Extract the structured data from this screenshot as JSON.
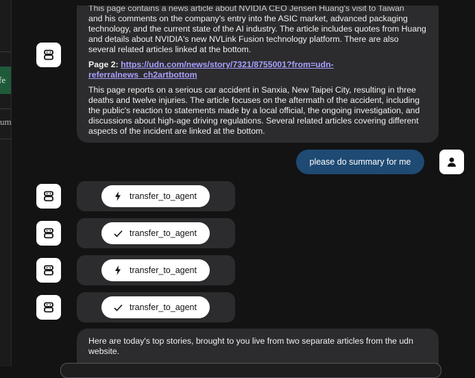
{
  "sidebar_fragments": {
    "item_a": "fe",
    "item_b": "um"
  },
  "messages": {
    "summary_top": {
      "clipped_line": "This page contains a news article about NVIDIA CEO Jensen Huang's visit to Taiwan",
      "para1": "and his comments on the company's entry into the ASIC market, advanced packaging technology, and the current state of the AI industry. The article includes quotes from Huang and details about NVIDIA's new NVLink Fusion technology platform. There are also several related articles linked at the bottom.",
      "page2_label": "Page 2:",
      "page2_link": "https://udn.com/news/story/7321/8755001?from=udn-referralnews_ch2artbottom",
      "para2": "This page reports on a serious car accident in Sanxia, New Taipei City, resulting in three deaths and twelve injuries. The article focuses on the aftermath of the accident, including the public's reaction to statements made by a local official, the ongoing investigation, and discussions about high-age driving regulations. Several related articles covering different aspects of the incident are linked at the bottom."
    },
    "user_message": "please do summary for me",
    "tool_calls": [
      {
        "name": "transfer_to_agent",
        "status_icon": "bolt-icon"
      },
      {
        "name": "transfer_to_agent",
        "status_icon": "check-icon"
      },
      {
        "name": "transfer_to_agent",
        "status_icon": "bolt-icon"
      },
      {
        "name": "transfer_to_agent",
        "status_icon": "check-icon"
      }
    ],
    "final_reply": "Here are today's top stories, brought to you live from two separate articles from the udn website."
  },
  "colors": {
    "background": "#131314",
    "bubble": "#2c2c2e",
    "user_bubble": "#1e4a73",
    "link": "#a9a1ff"
  }
}
